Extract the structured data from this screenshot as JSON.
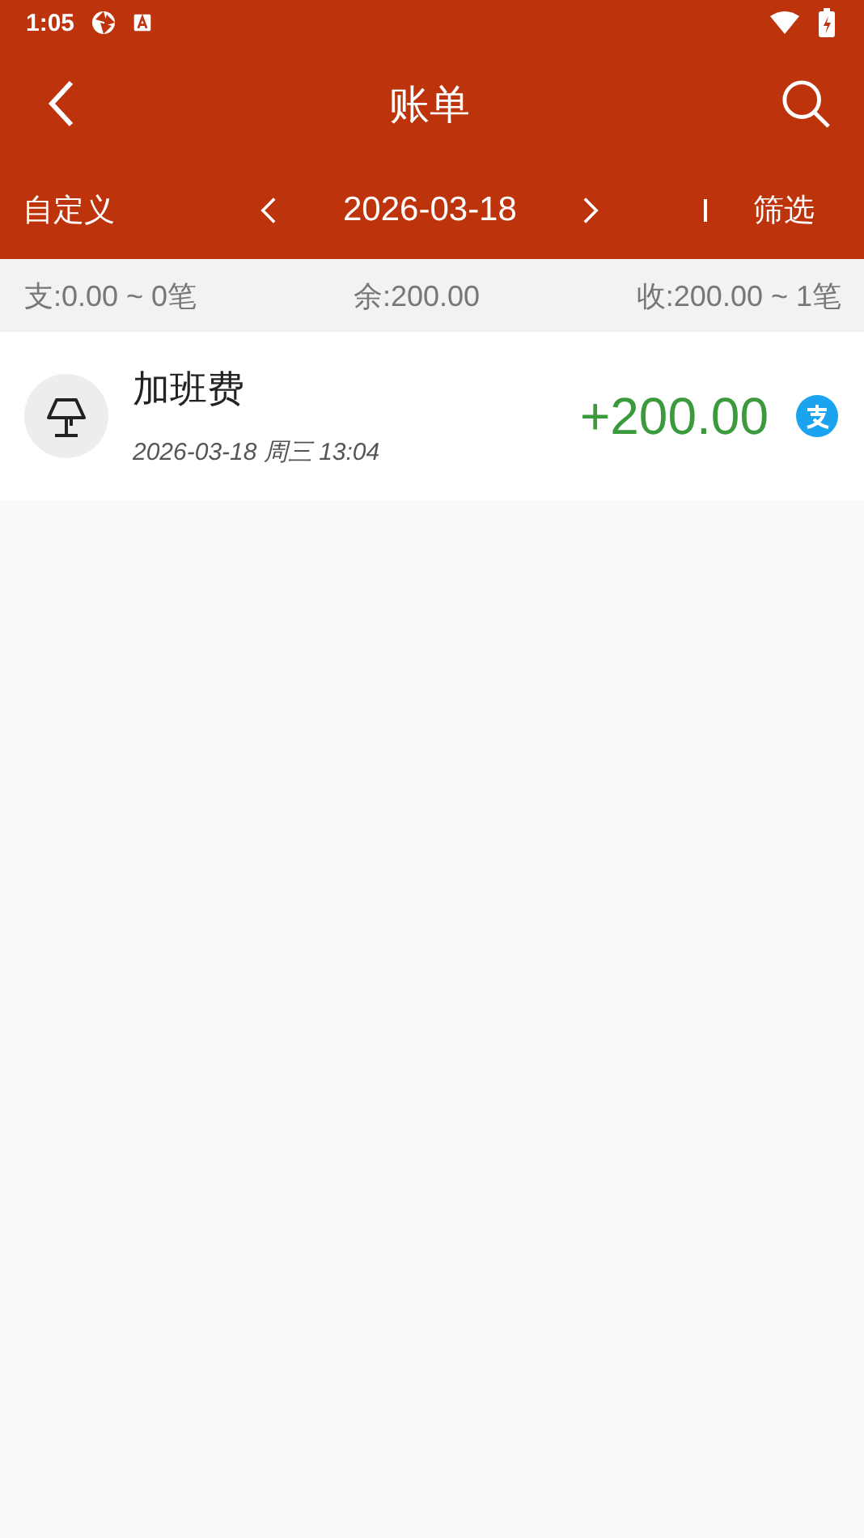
{
  "status_bar": {
    "time": "1:05"
  },
  "header": {
    "title": "账单"
  },
  "filter_bar": {
    "range_mode": "自定义",
    "date": "2026-03-18",
    "filter_label": "筛选"
  },
  "summary": {
    "expense": "支:0.00 ~ 0笔",
    "balance": "余:200.00",
    "income": "收:200.00 ~ 1笔"
  },
  "transactions": [
    {
      "title": "加班费",
      "datetime": "2026-03-18 周三 13:04",
      "amount": "+200.00",
      "kind": "income"
    }
  ]
}
